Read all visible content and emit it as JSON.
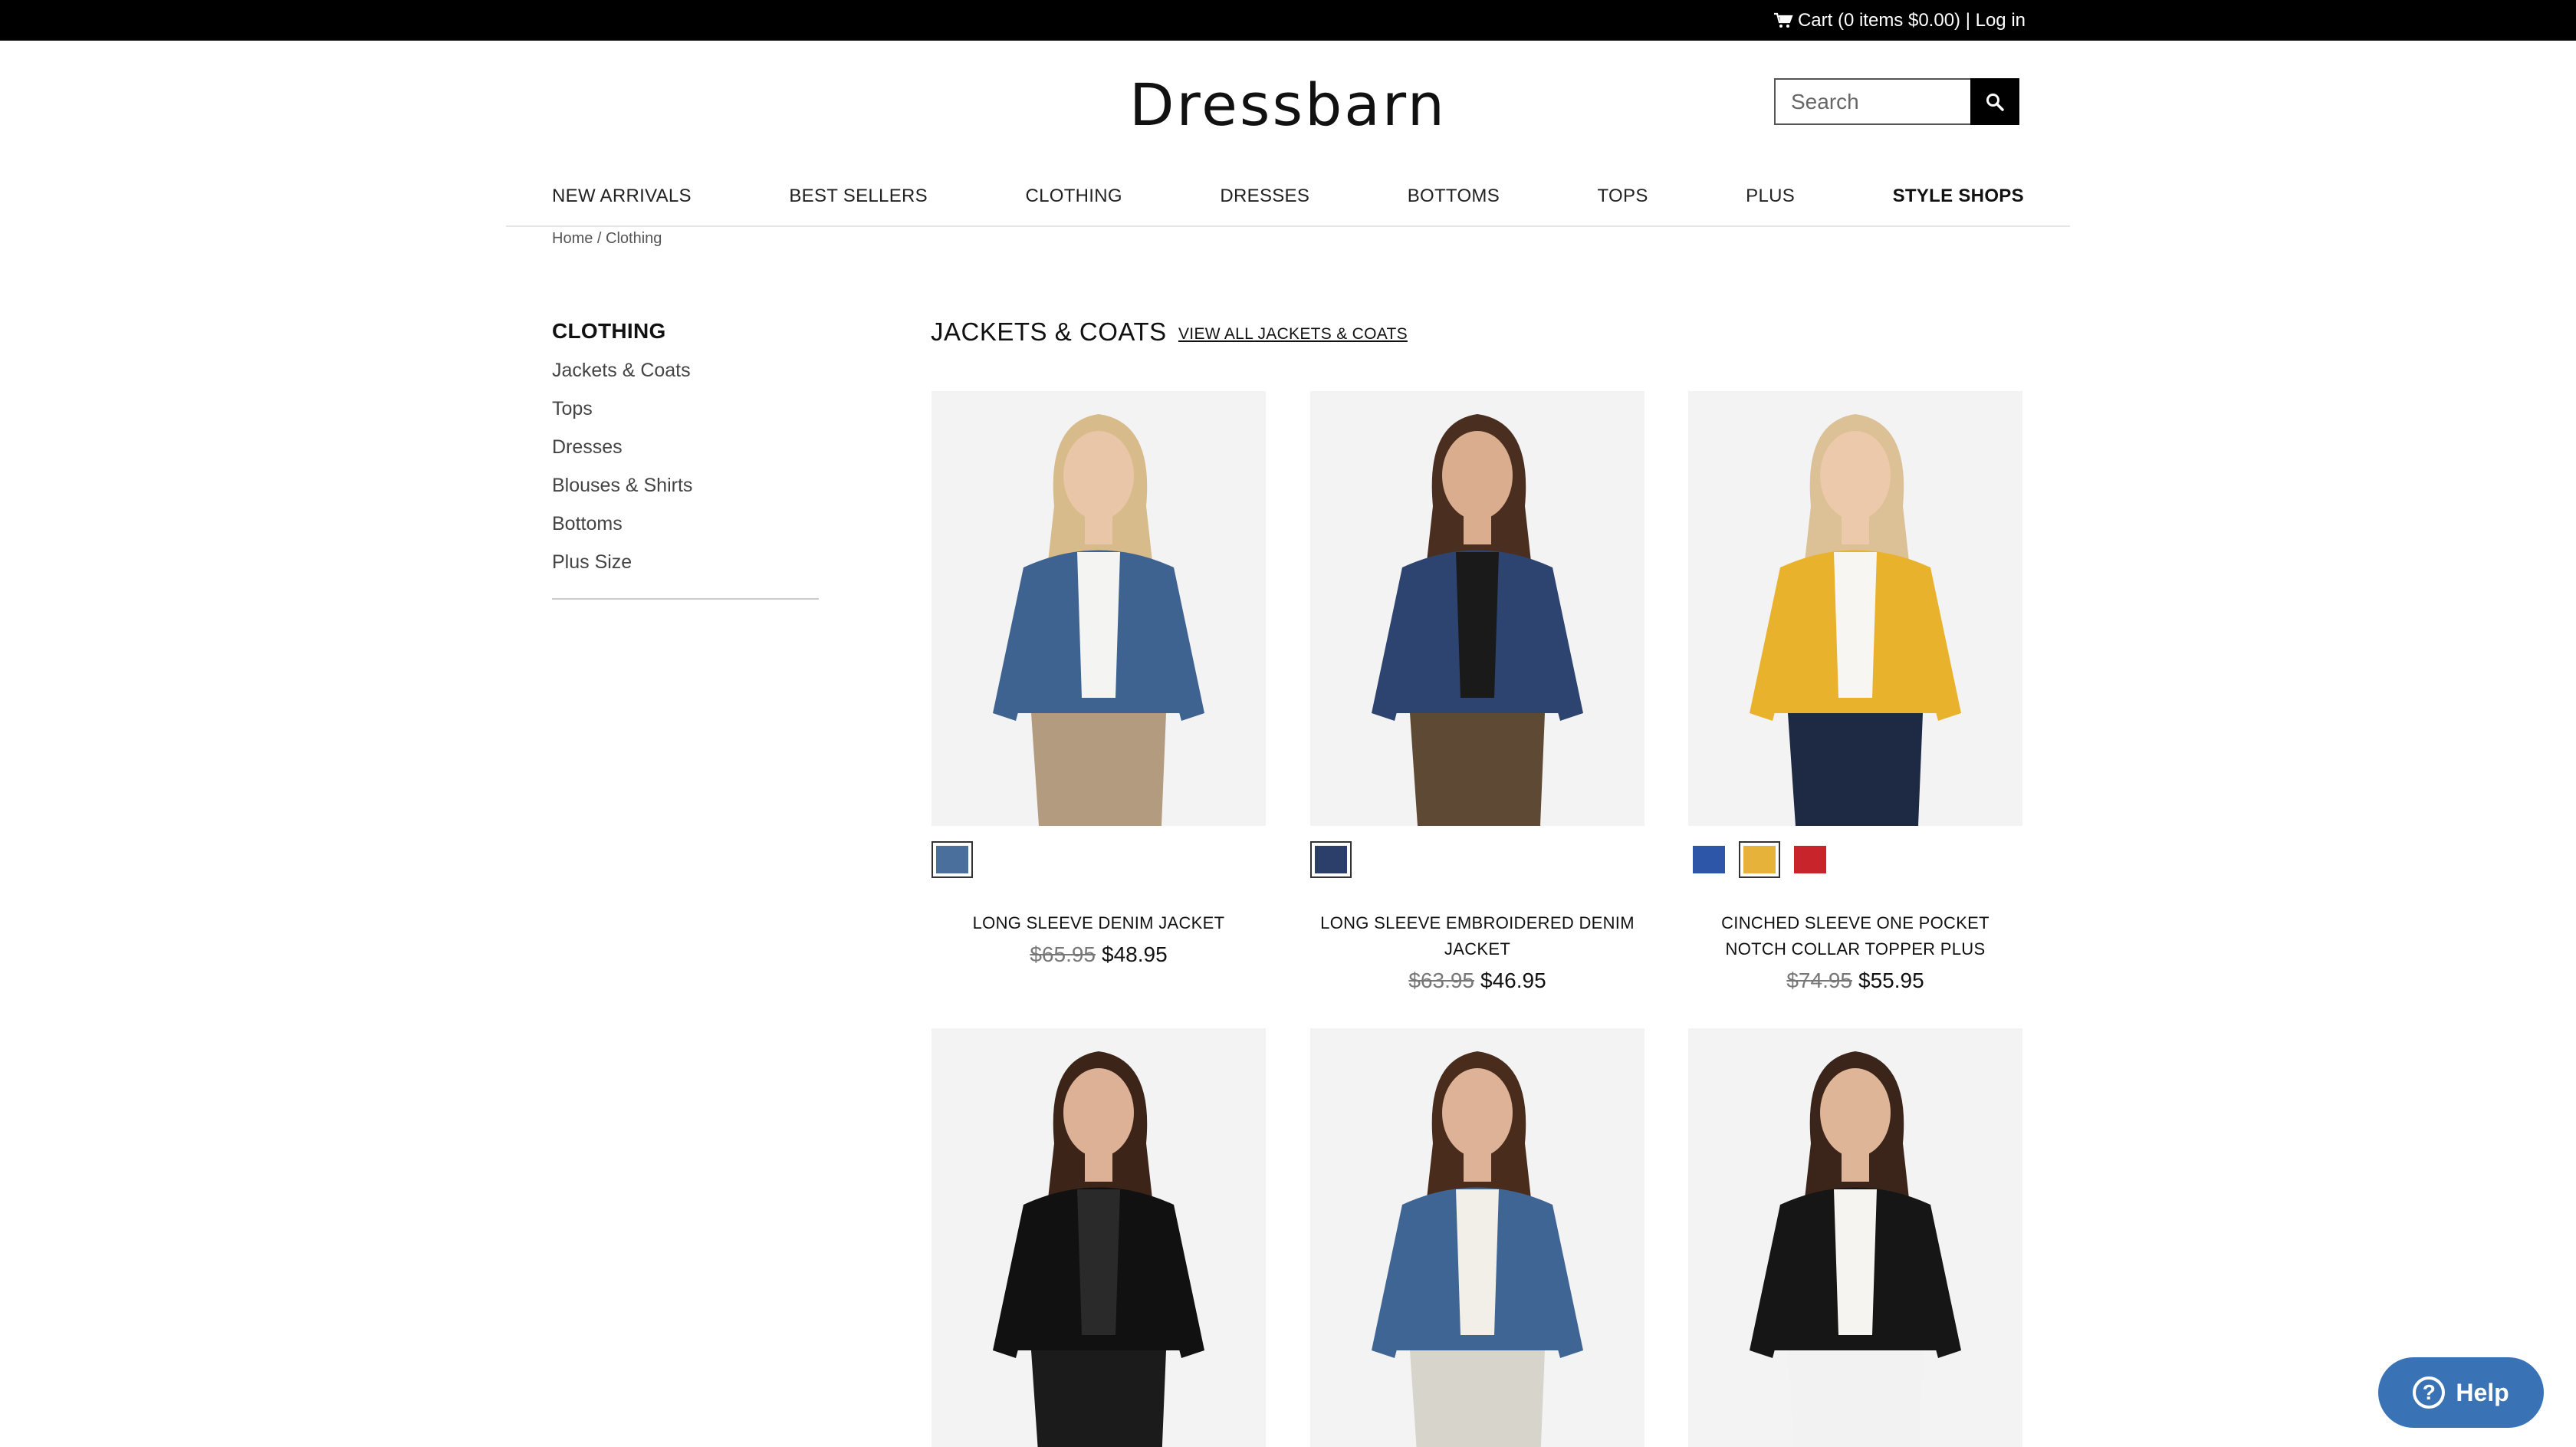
{
  "topbar": {
    "cart_label": "Cart (0 items $0.00)",
    "separator": " | ",
    "login_label": "Log in"
  },
  "header": {
    "logo": "Dressbarn",
    "search_placeholder": "Search"
  },
  "nav": {
    "items": [
      "NEW ARRIVALS",
      "BEST SELLERS",
      "CLOTHING",
      "DRESSES",
      "BOTTOMS",
      "TOPS",
      "PLUS",
      "STYLE SHOPS"
    ]
  },
  "breadcrumb": {
    "home": "Home",
    "sep": " / ",
    "current": "Clothing"
  },
  "sidebar": {
    "title": "CLOTHING",
    "items": [
      "Jackets & Coats",
      "Tops",
      "Dresses",
      "Blouses & Shirts",
      "Bottoms",
      "Plus Size"
    ]
  },
  "section": {
    "title": "JACKETS & COATS",
    "view_all": "VIEW ALL JACKETS & COATS"
  },
  "products": [
    {
      "name": "LONG SLEEVE DENIM JACKET",
      "old_price": "$65.95",
      "price": "$48.95",
      "swatches": [
        "#4a6f9c"
      ],
      "active_swatch": 0,
      "jacket_color": "#3e6391",
      "top_color": "#f4f4f2",
      "bottom_color": "#b39b80",
      "hair_color": "#d8bb8a",
      "skin_color": "#e9c6a8"
    },
    {
      "name": "LONG SLEEVE EMBROIDERED DENIM JACKET",
      "old_price": "$63.95",
      "price": "$46.95",
      "swatches": [
        "#2c3e6a"
      ],
      "active_swatch": 0,
      "jacket_color": "#2d4470",
      "top_color": "#1a1a1a",
      "bottom_color": "#5e4a34",
      "hair_color": "#4a2e20",
      "skin_color": "#d9ad8d"
    },
    {
      "name": "CINCHED SLEEVE ONE POCKET NOTCH COLLAR TOPPER PLUS",
      "old_price": "$74.95",
      "price": "$55.95",
      "swatches": [
        "#2e56a8",
        "#e6b23a",
        "#c8242b"
      ],
      "active_swatch": 1,
      "jacket_color": "#e8b22c",
      "top_color": "#f8f6f2",
      "bottom_color": "#1e2a44",
      "hair_color": "#dcc196",
      "skin_color": "#ecc9ab"
    },
    {
      "name": "",
      "old_price": "",
      "price": "",
      "swatches": [],
      "active_swatch": -1,
      "jacket_color": "#111111",
      "top_color": "#2a2a2a",
      "bottom_color": "#1b1b1b",
      "hair_color": "#3c2418",
      "skin_color": "#dcb196"
    },
    {
      "name": "",
      "old_price": "",
      "price": "",
      "swatches": [],
      "active_swatch": -1,
      "jacket_color": "#3f6594",
      "top_color": "#f1efe8",
      "bottom_color": "#d7d4cc",
      "hair_color": "#4a2c1d",
      "skin_color": "#ddb296"
    },
    {
      "name": "",
      "old_price": "",
      "price": "",
      "swatches": [],
      "active_swatch": -1,
      "jacket_color": "#161616",
      "top_color": "#f6f4f0",
      "bottom_color": "#f2f2f2",
      "hair_color": "#3b2419",
      "skin_color": "#dfb597"
    }
  ],
  "help": {
    "label": "Help",
    "glyph": "?"
  },
  "colors": {
    "topbar": "#000000",
    "help": "#3a73b5"
  },
  "icons": {
    "cart": "cart-icon",
    "search": "search-icon",
    "help": "help-icon"
  }
}
